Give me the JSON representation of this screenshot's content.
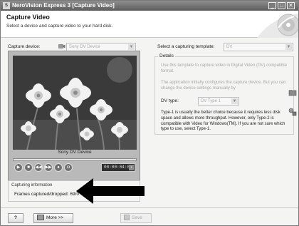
{
  "window": {
    "icon_glyph": "S",
    "title": "NeroVision Express 3 [Capture Video]",
    "controls": {
      "minimize": "_",
      "maximize": "□",
      "close": "✕"
    }
  },
  "header": {
    "title": "Capture Video",
    "subtitle": "Select a device and capture video to your hard disk."
  },
  "capture_device": {
    "label": "Capture device:",
    "value": "Sony DV Device",
    "icon": "camcorder-icon"
  },
  "template": {
    "label": "Select a capturing template:",
    "value": "DV"
  },
  "preview": {
    "caption": "Sony DV Device",
    "timecode": "00:00:04:01",
    "buttons": [
      "play",
      "stop",
      "rewind",
      "fast-forward",
      "record",
      "snapshot"
    ]
  },
  "capturing_info": {
    "legend": "Capturing information",
    "frames_label": "Frames captured/dropped: 69/0"
  },
  "details": {
    "legend": "Details",
    "note1": "Use this template to capture video in Digital Video (DV) compatible format.",
    "note2": "The application initially configures the capture device. But you can change the device settings manually by",
    "dv_type_label": "DV type:",
    "dv_type_value": "DV Type 1",
    "body": "Type-1 is usually the better choice because it requires less disk space and allows more throughput. However, only Type-2 is compatible with Video for Windows(TM). If you are not sure which type to use, select Type-1."
  },
  "footer": {
    "help_label": "?",
    "more_label": "More >>",
    "save_label": "Save"
  },
  "colors": {
    "titlebar": "#6e6e6e",
    "annotation_arrow": "#000000"
  }
}
